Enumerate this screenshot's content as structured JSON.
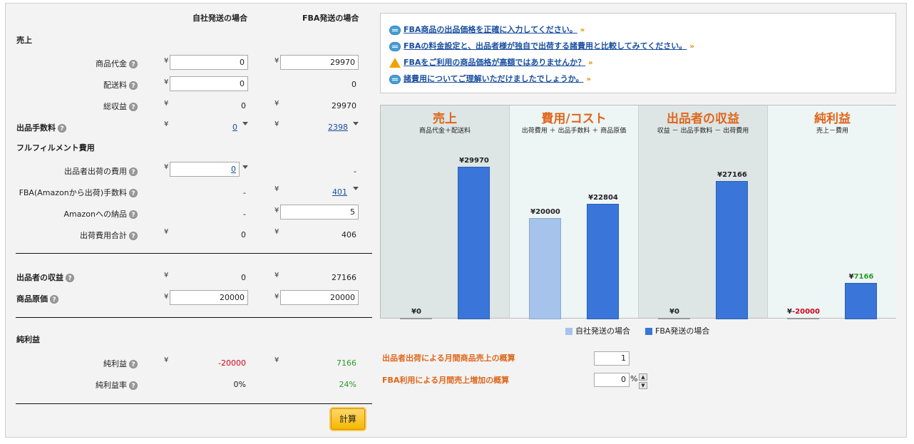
{
  "columns": {
    "self": "自社発送の場合",
    "fba": "FBA発送の場合"
  },
  "currency": "¥",
  "help_glyph": "?",
  "sections": {
    "sales": "売上",
    "fulfillment": "フルフィルメント費用",
    "net": "純利益"
  },
  "rows": {
    "item_price": {
      "label": "商品代金",
      "self": "0",
      "fba": "29970"
    },
    "shipping": {
      "label": "配送料",
      "self": "0",
      "fba": "0"
    },
    "total_revenue": {
      "label": "総収益",
      "self": "0",
      "fba": "29970"
    },
    "listing_fee": {
      "label": "出品手数料",
      "self": "0",
      "fba": "2398"
    },
    "seller_ship_cost": {
      "label": "出品者出荷の費用",
      "self": "0",
      "fba": "-"
    },
    "fba_fee": {
      "label": "FBA(Amazonから出荷)手数料",
      "self": "-",
      "fba": "401"
    },
    "amazon_inbound": {
      "label": "Amazonへの納品",
      "self": "-",
      "fba": "5"
    },
    "ship_total": {
      "label": "出荷費用合計",
      "self": "0",
      "fba": "406"
    },
    "seller_profit": {
      "label": "出品者の収益",
      "self": "0",
      "fba": "27166"
    },
    "cost_of_goods": {
      "label": "商品原価",
      "self": "20000",
      "fba": "20000"
    },
    "net_profit": {
      "label": "純利益",
      "self": "-20000",
      "fba": "7166"
    },
    "net_margin": {
      "label": "純利益率",
      "self": "0%",
      "fba": "24%"
    }
  },
  "calc_button": "計算",
  "notices": [
    {
      "text": "FBA商品の出品価格を正確に入力してください。",
      "icon": "speech-bubble-icon"
    },
    {
      "text": "FBAの料金設定と、出品者様が独自で出荷する諸費用と比較してみてください。",
      "icon": "speech-bubble-icon"
    },
    {
      "text": "FBAをご利用の商品価格が高額ではありませんか？",
      "icon": "warning-icon"
    },
    {
      "text": "諸費用についてご理解いただけましたでしょうか。",
      "icon": "speech-bubble-icon"
    }
  ],
  "chevron_glyph": "»",
  "colors": {
    "self": "#a6c3ec",
    "fba": "#3a75d9",
    "accent": "#e0661a"
  },
  "chart_data": {
    "type": "bar",
    "ylim": [
      0,
      32000
    ],
    "legend": [
      "自社発送の場合",
      "FBA発送の場合"
    ],
    "panels": [
      {
        "title": "売上",
        "subtitle": "商品代金＋配送料",
        "self": 0,
        "fba": 29970,
        "self_label": "¥0",
        "fba_label": "¥29970"
      },
      {
        "title": "費用/コスト",
        "subtitle": "出荷費用 ＋ 出品手数料 ＋ 商品原価",
        "self": 20000,
        "fba": 22804,
        "self_label": "¥20000",
        "fba_label": "¥22804"
      },
      {
        "title": "出品者の収益",
        "subtitle": "収益 － 出品手数料 － 出荷費用",
        "self": 0,
        "fba": 27166,
        "self_label": "¥0",
        "fba_label": "¥27166"
      },
      {
        "title": "純利益",
        "subtitle": "売上－費用",
        "self": -20000,
        "fba": 7166,
        "self_label": "¥-20000",
        "fba_label": "¥7166"
      }
    ]
  },
  "estimates": {
    "monthly_sales_label": "出品者出荷による月間商品売上の概算",
    "monthly_sales_value": "1",
    "fba_increase_label": "FBA利用による月間売上増加の概算",
    "fba_increase_value": "0",
    "percent": "%",
    "spin_up": "▲",
    "spin_down": "▼"
  }
}
